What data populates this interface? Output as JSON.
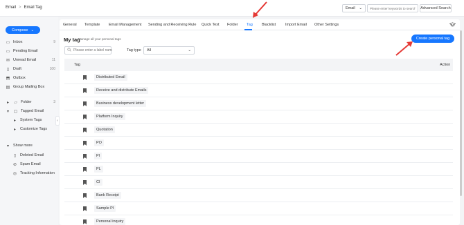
{
  "breadcrumb": {
    "root": "Email",
    "separator": ">",
    "current": "Email Tag"
  },
  "search": {
    "type": "Email",
    "placeholder": "Please enter keywords to search",
    "advanced_label": "Advanced Search"
  },
  "sidebar": {
    "compose_label": "Compose",
    "items": [
      {
        "label": "Inbox",
        "count": "9",
        "icon": "inbox-icon"
      },
      {
        "label": "Pending Email",
        "count": "",
        "icon": "pending-icon"
      },
      {
        "label": "Unread Email",
        "count": "11",
        "icon": "unread-icon"
      },
      {
        "label": "Draft",
        "count": "100",
        "icon": "draft-icon"
      },
      {
        "label": "Outbox",
        "count": "",
        "icon": "outbox-icon"
      },
      {
        "label": "Group Mailing Box",
        "count": "",
        "icon": "group-icon"
      },
      {
        "label": "Folder",
        "count": "3",
        "icon": "folder-icon"
      },
      {
        "label": "Tagged Email",
        "count": "",
        "icon": "tag-icon"
      },
      {
        "label": "System Tags",
        "count": "",
        "icon": "bullet"
      },
      {
        "label": "Customize Tags",
        "count": "",
        "icon": "bullet"
      },
      {
        "label": "Show more",
        "count": "",
        "icon": "chevron-down-icon"
      },
      {
        "label": "Deleted Email",
        "count": "",
        "icon": "trash-icon"
      },
      {
        "label": "Spam Email",
        "count": "",
        "icon": "spam-icon"
      },
      {
        "label": "Tracking Information",
        "count": "",
        "icon": "tracking-icon"
      }
    ]
  },
  "tabs": [
    "General",
    "Template",
    "Email Management",
    "Sending and Receiving Rule",
    "Quick Text",
    "Folder",
    "Tag",
    "Blacklist",
    "Import Email",
    "Other Settings"
  ],
  "active_tab": "Tag",
  "section": {
    "title": "My tag",
    "subtitle": "Manage all your personal tags",
    "create_label": "Create personal tag"
  },
  "filter": {
    "placeholder": "Please enter a label name",
    "type_label": "Tag type",
    "type_value": "All"
  },
  "table": {
    "headers": {
      "tag": "Tag",
      "action": "Action"
    },
    "rows": [
      "Distributed Email",
      "Receive and distribute Emails",
      "Business development letter",
      "Platform Inquiry",
      "Quotation",
      "PO",
      "PI",
      "PL",
      "CI",
      "Bank Receipt",
      "Sample PI",
      "Personal inquiry"
    ]
  },
  "colors": {
    "accent": "#1677ff",
    "arrow": "#e53935"
  }
}
